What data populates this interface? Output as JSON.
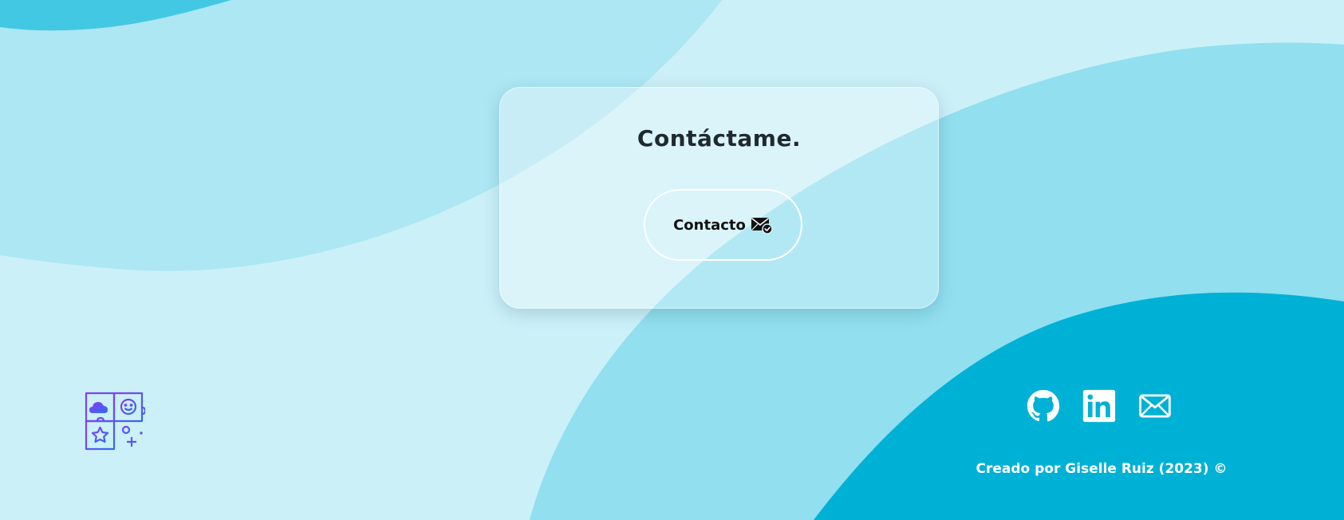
{
  "contact_card": {
    "title": "Contáctame.",
    "button_label": "Contacto",
    "button_icon": "envelope-check-icon"
  },
  "logo": {
    "icon": "app-grid-logo-icon"
  },
  "footer": {
    "social_icons": [
      "github-icon",
      "linkedin-icon",
      "mail-icon"
    ],
    "credit": "Creado por Giselle Ruiz (2023) ©"
  },
  "colors": {
    "background": "#cbf0f8",
    "blob_light": "#ace7f3",
    "blob_mid": "#91dfef",
    "blob_dark": "#00b1d6",
    "blob_top": "#42c8e3",
    "text_dark": "#1f2a30",
    "white": "#ffffff",
    "logo_purple": "#8a3cf0",
    "logo_blue": "#2f6cf3"
  }
}
